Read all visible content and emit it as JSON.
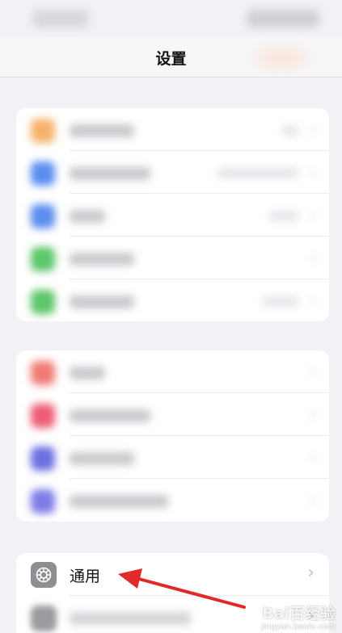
{
  "nav": {
    "title": "设置"
  },
  "group1": {
    "rows": [
      {
        "icon_color": "#f6b26b",
        "label_width": 80,
        "value_width": 20
      },
      {
        "icon_color": "#5b8def",
        "label_width": 100,
        "value_width": 100
      },
      {
        "icon_color": "#5b8def",
        "label_width": 44,
        "value_width": 36
      },
      {
        "icon_color": "#5cc66a",
        "label_width": 80,
        "value_width": 0
      },
      {
        "icon_color": "#5cc66a",
        "label_width": 80,
        "value_width": 44
      }
    ]
  },
  "group2": {
    "rows": [
      {
        "icon_color": "#f07b74",
        "label_width": 44,
        "value_width": 0
      },
      {
        "icon_color": "#ee5c75",
        "label_width": 100,
        "value_width": 0
      },
      {
        "icon_color": "#6c6fe0",
        "label_width": 80,
        "value_width": 0
      },
      {
        "icon_color": "#7d7be6",
        "label_width": 122,
        "value_width": 0
      }
    ]
  },
  "general": {
    "label": "通用",
    "icon": "gear-icon",
    "chevron": "›"
  },
  "annotation": {
    "arrow_color": "#e02a2a"
  },
  "watermark": {
    "main": "Bai百经验",
    "sub": "jingyan.baidu.com"
  }
}
